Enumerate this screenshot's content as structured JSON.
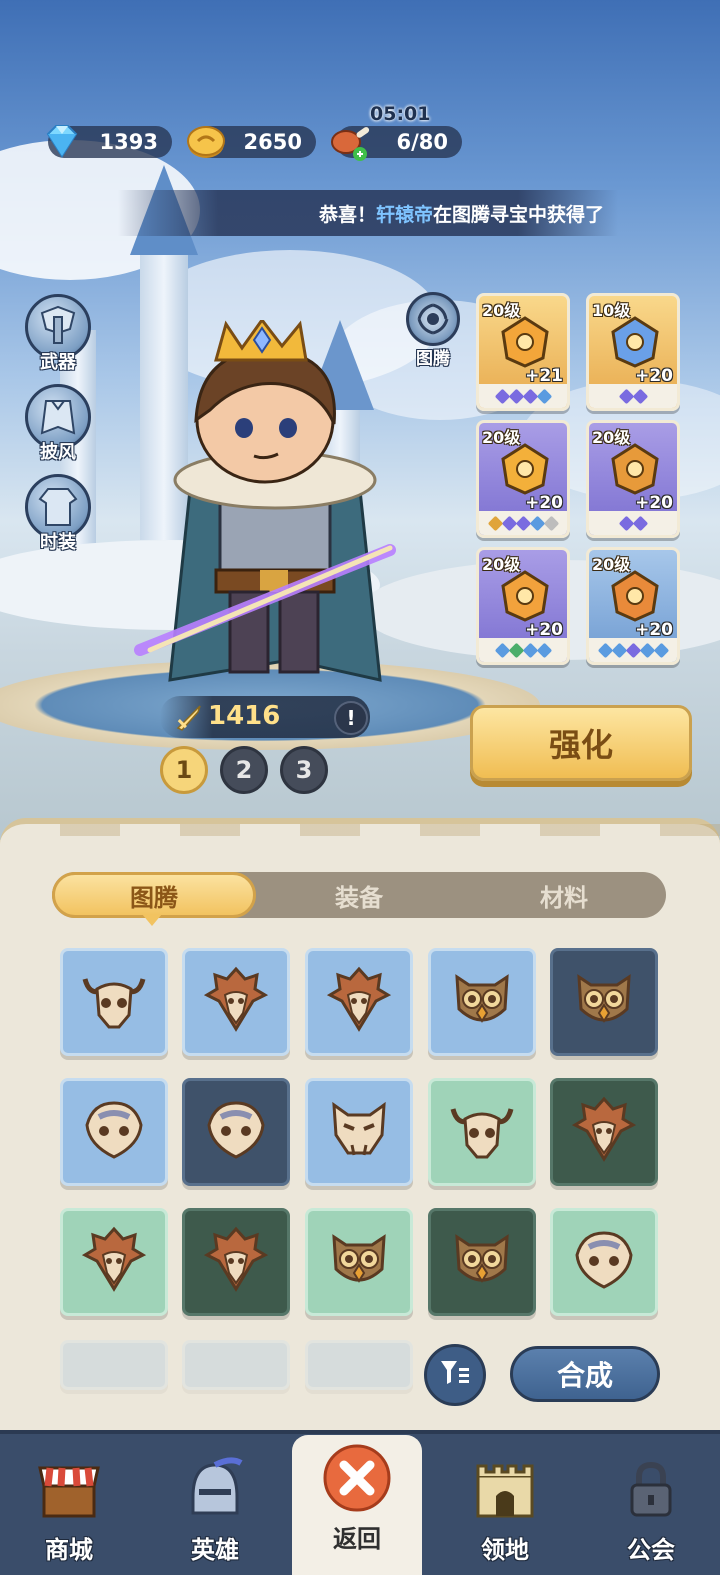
{
  "resources": {
    "gems": "1393",
    "coins": "2650",
    "stamina": "6/80",
    "timer": "05:01"
  },
  "announcement": {
    "prefix": "恭喜！",
    "player": "轩辕帝",
    "suffix": "在图腾寻宝中获得了"
  },
  "equip_slots": [
    {
      "label": "武器",
      "icon": "weapon-slot-icon"
    },
    {
      "label": "披风",
      "icon": "cape-slot-icon"
    },
    {
      "label": "时装",
      "icon": "costume-slot-icon"
    }
  ],
  "hero": {
    "power": "1416",
    "info": "!"
  },
  "pages": [
    "1",
    "2",
    "3"
  ],
  "totem_button_label": "图腾",
  "totem_slots": [
    {
      "level": "20级",
      "bonus": "+21",
      "color": "gold",
      "gems": [
        "#7a6be0",
        "#7a6be0",
        "#7a6be0",
        "#5a9be0"
      ]
    },
    {
      "level": "10级",
      "bonus": "+20",
      "color": "gold",
      "gems": [
        "#7a6be0",
        "#7a6be0"
      ]
    },
    {
      "level": "20级",
      "bonus": "+20",
      "color": "purple",
      "gems": [
        "#e0a43a",
        "#7a6be0",
        "#7a6be0",
        "#5a9be0",
        "#bdbdbd"
      ]
    },
    {
      "level": "20级",
      "bonus": "+20",
      "color": "purple",
      "gems": [
        "#7a6be0",
        "#7a6be0"
      ]
    },
    {
      "level": "20级",
      "bonus": "+20",
      "color": "purple",
      "gems": [
        "#5a9be0",
        "#4cae6a",
        "#5a9be0",
        "#5a9be0"
      ]
    },
    {
      "level": "20级",
      "bonus": "+20",
      "color": "blue",
      "gems": [
        "#5a9be0",
        "#5a9be0",
        "#7a6be0",
        "#5a9be0",
        "#5a9be0"
      ]
    }
  ],
  "strengthen_label": "强化",
  "tabs": [
    "图腾",
    "装备",
    "材料"
  ],
  "active_tab": "图腾",
  "inventory": [
    {
      "type": "bull-skull",
      "rarity": "blue"
    },
    {
      "type": "bird-skull",
      "rarity": "blue"
    },
    {
      "type": "bird-skull",
      "rarity": "blue"
    },
    {
      "type": "owl-mask",
      "rarity": "blue"
    },
    {
      "type": "owl-mask",
      "rarity": "darkblue"
    },
    {
      "type": "serpent-mask",
      "rarity": "blue"
    },
    {
      "type": "serpent-mask",
      "rarity": "darkblue"
    },
    {
      "type": "tiger-skull",
      "rarity": "blue"
    },
    {
      "type": "bull-skull",
      "rarity": "green"
    },
    {
      "type": "bird-skull",
      "rarity": "darkgreen"
    },
    {
      "type": "bird-skull",
      "rarity": "green"
    },
    {
      "type": "bird-skull",
      "rarity": "darkgreen"
    },
    {
      "type": "owl-mask",
      "rarity": "green"
    },
    {
      "type": "owl-mask",
      "rarity": "darkgreen"
    },
    {
      "type": "serpent-mask",
      "rarity": "green"
    }
  ],
  "merge_label": "合成",
  "nav": [
    {
      "label": "商城",
      "icon": "shop-icon"
    },
    {
      "label": "英雄",
      "icon": "hero-helmet-icon"
    },
    {
      "label": "返回",
      "icon": "close-icon",
      "active": true
    },
    {
      "label": "领地",
      "icon": "castle-icon"
    },
    {
      "label": "公会",
      "icon": "lock-icon"
    }
  ],
  "colors": {
    "accent_gold": "#f2c360",
    "panel_bg": "#ece7da",
    "nav_bg": "#3a4d6a"
  }
}
